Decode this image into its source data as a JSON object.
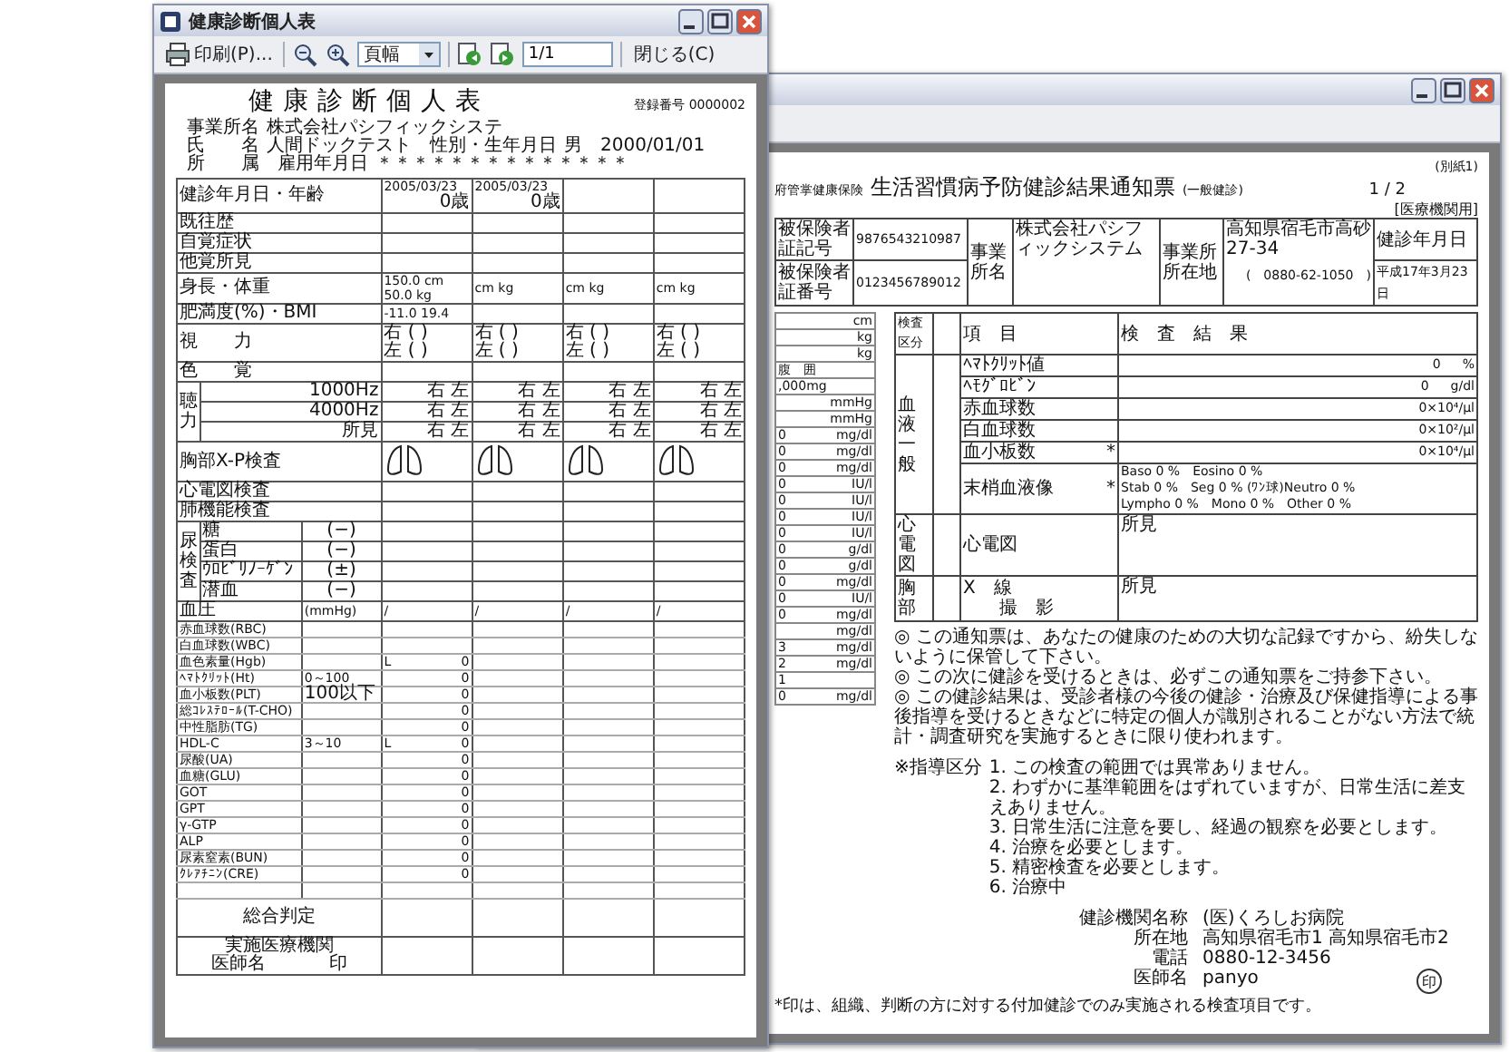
{
  "front_window": {
    "title": "健康診断個人表",
    "toolbar": {
      "print_label": "印刷(P)...",
      "zoom_value": "頁幅",
      "page_value": "1/1",
      "close_label": "閉じる(C)"
    },
    "document": {
      "title": "健康診断個人表",
      "reg_label": "登録番号",
      "reg_no": "0000002",
      "info": [
        {
          "items": [
            {
              "label": "事業所名",
              "value": "株式会社パシフィックシステ"
            }
          ]
        },
        {
          "items": [
            {
              "label": "氏　　名",
              "value": "人間ドックテスト"
            },
            {
              "label": "性別・生年月日",
              "value": "男　2000/01/01"
            }
          ]
        },
        {
          "items": [
            {
              "label": "所　　属"
            },
            {
              "label": "雇用年月日",
              "value": "＊＊＊＊＊＊＊＊＊＊＊＊＊＊"
            }
          ]
        }
      ],
      "rows": [
        {
          "kind": "plain",
          "label": "健診年月日・年齢",
          "cells": [
            {
              "lines": [
                "2005/03/23",
                "0歳"
              ]
            },
            {
              "lines": [
                "2005/03/23",
                "0歳"
              ]
            }
          ]
        },
        {
          "kind": "plain",
          "label": "既往歴"
        },
        {
          "kind": "plain",
          "label": "自覚症状"
        },
        {
          "kind": "plain",
          "label": "他覚所見"
        },
        {
          "kind": "plain",
          "label": "身長・体重",
          "cells": [
            {
              "lines": [
                "150.0 cm",
                "50.0 kg"
              ]
            },
            "cm kg",
            "cm kg",
            "cm kg"
          ]
        },
        {
          "kind": "plain",
          "label": "肥満度(%)・BMI",
          "cells": [
            "-11.0 19.4"
          ]
        },
        {
          "kind": "plain",
          "label": "視　　力",
          "cells": [
            {
              "lines": [
                "右 (   )",
                "左 (   )"
              ]
            },
            {
              "lines": [
                "右 (   )",
                "左 (   )"
              ]
            },
            {
              "lines": [
                "右 (   )",
                "左 (   )"
              ]
            },
            {
              "lines": [
                "右 (   )",
                "左 (   )"
              ]
            }
          ]
        },
        {
          "kind": "plain",
          "label": "色　　覚"
        },
        {
          "kind": "group",
          "label": "聴力",
          "subrows": [
            {
              "label": "1000Hz",
              "cells": [
                "右 左",
                "右 左",
                "右 左",
                "右 左"
              ]
            },
            {
              "label": "4000Hz",
              "cells": [
                "右 左",
                "右 左",
                "右 左",
                "右 左"
              ]
            },
            {
              "label": "所見",
              "cells": [
                "右 左",
                "右 左",
                "右 左",
                "右 左"
              ]
            }
          ]
        },
        {
          "kind": "xray",
          "label": "胸部X-P検査"
        },
        {
          "kind": "plain",
          "label": "心電図検査"
        },
        {
          "kind": "plain",
          "label": "肺機能検査"
        },
        {
          "kind": "group",
          "label": "尿検査",
          "subrows": [
            {
              "label": "糖",
              "ref": "(−)"
            },
            {
              "label": "蛋白",
              "ref": "(−)"
            },
            {
              "label": "ｳﾛﾋﾞﾘﾉｰｹﾞﾝ",
              "ref": "(±)"
            },
            {
              "label": "潜血",
              "ref": "(−)"
            }
          ]
        },
        {
          "kind": "plain",
          "label": "血圧",
          "ref": "(mmHg)",
          "cells": [
            "/",
            "/",
            "/",
            "/"
          ]
        },
        {
          "kind": "lab",
          "label": "赤血球数(RBC)"
        },
        {
          "kind": "lab",
          "label": "白血球数(WBC)"
        },
        {
          "kind": "lab",
          "label": "血色素量(Hgb)",
          "flag": "L",
          "value": "0"
        },
        {
          "kind": "lab",
          "label": "ﾍﾏﾄｸﾘｯﾄ(Ht)",
          "ref": "0～100",
          "value": "0"
        },
        {
          "kind": "lab",
          "label": "血小板数(PLT)",
          "ref": "100以下",
          "value": "0"
        },
        {
          "kind": "lab",
          "label": "総ｺﾚｽﾃﾛｰﾙ(T-CHO)",
          "value": "0"
        },
        {
          "kind": "lab",
          "label": "中性脂肪(TG)",
          "value": "0"
        },
        {
          "kind": "lab",
          "label": "HDL-C",
          "ref": "3～10",
          "flag": "L",
          "value": "0"
        },
        {
          "kind": "lab",
          "label": "尿酸(UA)",
          "value": "0"
        },
        {
          "kind": "lab",
          "label": "血糖(GLU)",
          "value": "0"
        },
        {
          "kind": "lab",
          "label": "GOT",
          "value": "0"
        },
        {
          "kind": "lab",
          "label": "GPT",
          "value": "0"
        },
        {
          "kind": "lab",
          "label": "γ-GTP",
          "value": "0"
        },
        {
          "kind": "lab",
          "label": "ALP",
          "value": "0"
        },
        {
          "kind": "lab",
          "label": "尿素窒素(BUN)",
          "value": "0"
        },
        {
          "kind": "lab",
          "label": "ｸﾚｱﾁﾆﾝ(CRE)",
          "value": "0"
        },
        {
          "kind": "big",
          "label": "総合判定"
        },
        {
          "kind": "big",
          "label": "実施医療機関",
          "label2": "医師名",
          "mark": "印"
        }
      ]
    }
  },
  "back_window": {
    "document": {
      "form_no": "(別紙1)",
      "insurer": "府管掌健康保険",
      "title": "生活習慣病予防健診結果通知票",
      "subtitle": "(一般健診)",
      "page": "1 / 2",
      "copy": "[医療機関用]",
      "header": {
        "id_label": "被保険者証記号",
        "id_value": "9876543210987",
        "no_label": "被保険者証番号",
        "no_value": "0123456789012",
        "company_label": "事業所名",
        "company_value": "株式会社パシフィックシステム",
        "address_label": "事業所所在地",
        "address_value": "高知県宿毛市高砂 27-34",
        "phone": "(　0880-62-1050　)",
        "date_label": "健診年月日",
        "date_value": "平成17年3月23日"
      },
      "strip": [
        {
          "unit": "cm"
        },
        {
          "unit": "kg"
        },
        {
          "unit": "kg"
        },
        {
          "label": "腹　囲"
        },
        {
          "label": ",000mg"
        },
        {
          "unit": "mmHg"
        },
        {
          "unit": "mmHg"
        },
        {
          "value": "0",
          "unit": "mg/dl"
        },
        {
          "value": "0",
          "unit": "mg/dl"
        },
        {
          "value": "0",
          "unit": "mg/dl"
        },
        {
          "value": "0",
          "unit": "IU/l"
        },
        {
          "value": "0",
          "unit": "IU/l"
        },
        {
          "value": "0",
          "unit": "IU/l"
        },
        {
          "value": "0",
          "unit": "IU/l"
        },
        {
          "value": "0",
          "unit": "g/dl"
        },
        {
          "value": "0",
          "unit": "g/dl"
        },
        {
          "value": "0",
          "unit": "mg/dl"
        },
        {
          "value": "0",
          "unit": "IU/l"
        },
        {
          "value": "0",
          "unit": "mg/dl"
        },
        {
          "unit": "mg/dl"
        },
        {
          "value": "3",
          "unit": "mg/dl"
        },
        {
          "value": "2",
          "unit": "mg/dl"
        },
        {
          "value": "1"
        },
        {
          "value": "0",
          "unit": "mg/dl"
        }
      ],
      "results_header": {
        "section": "検査区分",
        "item": "項　目",
        "result": "検　査　結　果"
      },
      "sections": [
        {
          "label": "血液一般",
          "rows": [
            {
              "item": "ﾍﾏﾄｸﾘｯﾄ値",
              "value": "0",
              "unit": "%"
            },
            {
              "item": "ﾍﾓｸﾞﾛﾋﾞﾝ",
              "value": "0",
              "unit": "g/dl"
            },
            {
              "item": "赤血球数",
              "value": "0×10⁴/μl"
            },
            {
              "item": "白血球数",
              "value": "0×10²/μl"
            },
            {
              "item": "血小板数",
              "star": "*",
              "value": "0×10⁴/μl"
            },
            {
              "item": "末梢血液像",
              "star": "*",
              "lines": [
                "Baso 0 %　Eosino 0 %",
                "Stab 0 %　Seg 0 % (ﾜﾝ球)Neutro 0 %",
                "Lympho 0 %　Mono 0 %　Other 0 %"
              ]
            }
          ]
        },
        {
          "label": "心電図",
          "rows": [
            {
              "item": "心電図",
              "value": "所見"
            }
          ]
        },
        {
          "label": "胸部",
          "rows": [
            {
              "item": "X　線",
              "item2": "撮　影",
              "value": "所見"
            }
          ]
        }
      ],
      "notes": [
        "◎ この通知票は、あなたの健康のための大切な記録ですから、紛失しないように保管して下さい。",
        "◎ この次に健診を受けるときは、必ずこの通知票をご持参下さい。",
        "◎ この健診結果は、受診者様の今後の健診・治療及び保健指導による事後指導を受けるときなどに特定の個人が識別されることがない方法で統計・調査研究を実施するときに限り使われます。"
      ],
      "guidance_label": "※指導区分",
      "guidance": [
        "1. この検査の範囲では異常ありません。",
        "2. わずかに基準範囲をはずれていますが、日常生活に差支えありません。",
        "3. 日常生活に注意を要し、経過の観察を必要とします。",
        "4. 治療を必要とします。",
        "5. 精密検査を必要とします。",
        "6. 治療中"
      ],
      "institution": [
        {
          "label": "健診機関名称",
          "value": "(医)くろしお病院"
        },
        {
          "label": "所在地",
          "value": "高知県宿毛市1 高知県宿毛市2"
        },
        {
          "label": "電話",
          "value": "0880-12-3456"
        },
        {
          "label": "医師名",
          "value": "panyo",
          "stamp": "印"
        }
      ],
      "footnote": "*印は、組織、判断の方に対する付加健診でのみ実施される検査項目です。"
    }
  }
}
